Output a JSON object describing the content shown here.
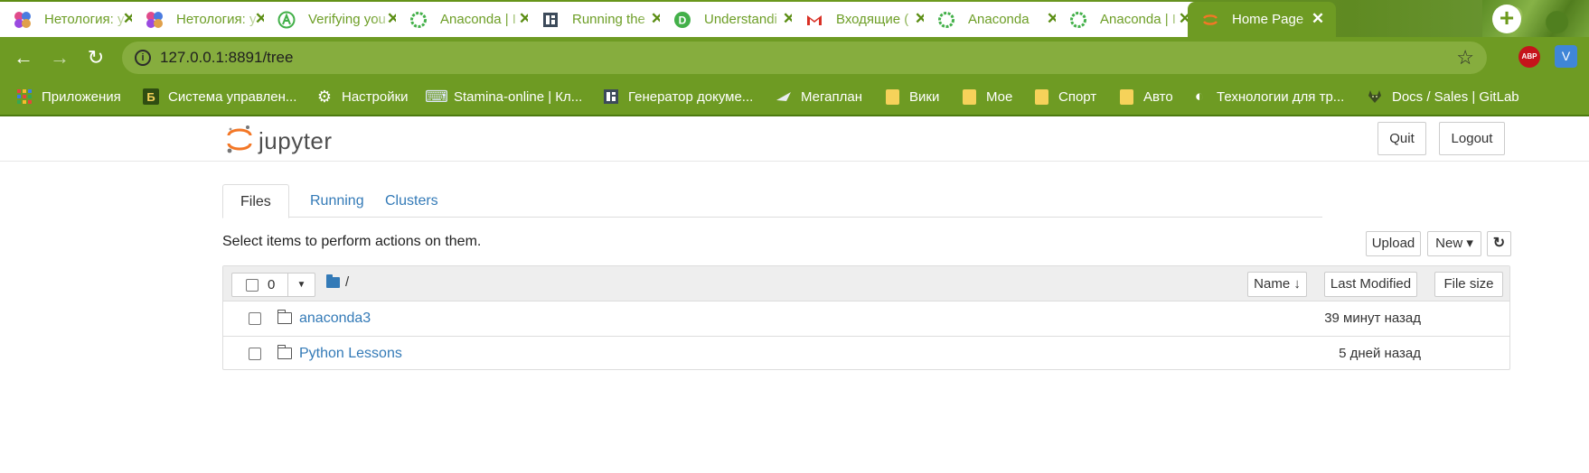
{
  "browser": {
    "tabs": [
      {
        "title": "Нетология: у",
        "icon": "netology-icon"
      },
      {
        "title": "Нетология: у",
        "icon": "netology-icon"
      },
      {
        "title": "Verifying you",
        "icon": "anaconda-a-icon"
      },
      {
        "title": "Anaconda | I",
        "icon": "anaconda-ring-icon"
      },
      {
        "title": "Running the",
        "icon": "document-icon"
      },
      {
        "title": "Understandi",
        "icon": "d-circle-icon"
      },
      {
        "title": "Входящие (",
        "icon": "gmail-icon"
      },
      {
        "title": "Anaconda",
        "icon": "anaconda-ring-icon"
      },
      {
        "title": "Anaconda | I",
        "icon": "anaconda-ring-icon"
      },
      {
        "title": "Home Page",
        "icon": "jupyter-icon",
        "active": true
      }
    ],
    "close_glyph": "✕",
    "new_tab_glyph": "+",
    "url": "127.0.0.1:8891/tree",
    "extensions": {
      "abp": "ABP",
      "v": "V"
    },
    "bookmarks": [
      {
        "label": "Приложения",
        "icon": "apps-grid-icon"
      },
      {
        "label": "Система управлен...",
        "icon": "b-badge-icon",
        "glyph": "Б"
      },
      {
        "label": "Настройки",
        "icon": "gear-icon",
        "glyph": "⚙"
      },
      {
        "label": "Stamina-online | Кл...",
        "icon": "keyboard-icon",
        "glyph": "⌨"
      },
      {
        "label": "Генератор докуме...",
        "icon": "document-icon"
      },
      {
        "label": "Мегаплан",
        "icon": "megaplan-icon"
      },
      {
        "label": "Вики",
        "icon": "folder-icon"
      },
      {
        "label": "Мое",
        "icon": "folder-icon"
      },
      {
        "label": "Спорт",
        "icon": "folder-icon"
      },
      {
        "label": "Авто",
        "icon": "folder-icon"
      },
      {
        "label": "Технологии для тр...",
        "icon": "globe-icon",
        "glyph": "◐"
      },
      {
        "label": "Docs / Sales | GitLab",
        "icon": "gitlab-icon"
      }
    ]
  },
  "jupyter": {
    "logo_text": "jupyter",
    "quit_label": "Quit",
    "logout_label": "Logout",
    "tabs": [
      "Files",
      "Running",
      "Clusters"
    ],
    "tip": "Select items to perform actions on them.",
    "upload_label": "Upload",
    "new_label": "New ▾",
    "refresh_glyph": "↻",
    "selected_count": "0",
    "breadcrumb": "/",
    "sort_buttons": {
      "name": "Name ↓",
      "modified": "Last Modified",
      "size": "File size"
    },
    "items": [
      {
        "name": "anaconda3",
        "modified": "39 минут назад"
      },
      {
        "name": "Python Lessons",
        "modified": "5 дней назад"
      }
    ],
    "colors": {
      "link": "#337ab7",
      "logo_orange": "#f37726",
      "chrome_green": "#6e9b23"
    }
  }
}
